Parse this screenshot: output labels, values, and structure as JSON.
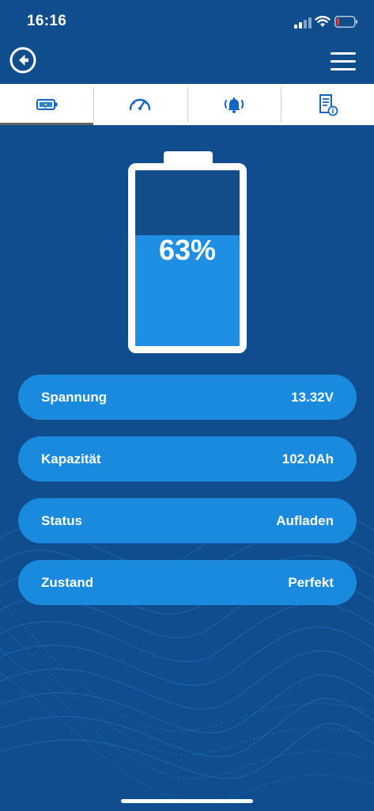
{
  "status_bar": {
    "time": "16:16",
    "signal_icon": "cellular-signal-icon",
    "wifi_icon": "wifi-icon",
    "battery_icon": "battery-low-icon"
  },
  "header": {
    "back_icon": "back-arrow-icon",
    "menu_icon": "hamburger-menu-icon"
  },
  "tabs": [
    {
      "icon": "battery-tab-icon",
      "active": true
    },
    {
      "icon": "speedometer-icon",
      "active": false
    },
    {
      "icon": "alarm-bell-icon",
      "active": false
    },
    {
      "icon": "document-info-icon",
      "active": false
    }
  ],
  "battery": {
    "percent_label": "63%",
    "level": 0.63
  },
  "info": [
    {
      "label": "Spannung",
      "value": "13.32V"
    },
    {
      "label": "Kapazität",
      "value": "102.0Ah"
    },
    {
      "label": "Status",
      "value": "Aufladen"
    },
    {
      "label": "Zustand",
      "value": "Perfekt"
    }
  ],
  "colors": {
    "background": "#0f4d8c",
    "accent": "#1a8ade",
    "battery_fill": "#1e8fe2",
    "low_battery_red": "#e53935"
  }
}
